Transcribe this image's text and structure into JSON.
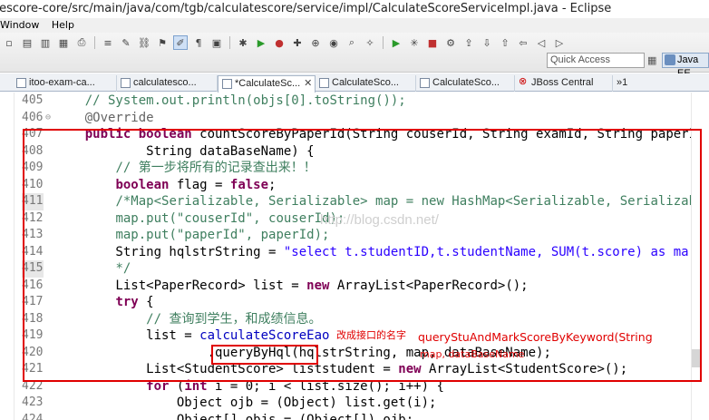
{
  "window": {
    "title": "tescore-core/src/main/java/com/tgb/calculatescore/service/impl/CalculateScoreServiceImpl.java - Eclipse"
  },
  "menu": [
    "Window",
    "Help"
  ],
  "toolbar": {
    "quick_access_placeholder": "Quick Access",
    "perspective_label": "Java EE"
  },
  "tabs": [
    {
      "label": "itoo-exam-ca...",
      "active": false,
      "closable": false
    },
    {
      "label": "calculatesco...",
      "active": false,
      "closable": false
    },
    {
      "label": "*CalculateSc...",
      "active": true,
      "closable": true
    },
    {
      "label": "CalculateSco...",
      "active": false,
      "closable": false
    },
    {
      "label": "CalculateSco...",
      "active": false,
      "closable": false
    },
    {
      "label": "JBoss Central",
      "active": false,
      "closable": false
    },
    {
      "label": "»1",
      "active": false,
      "closable": false
    }
  ],
  "editor": {
    "lines": [
      {
        "num": "405",
        "hl": false,
        "fold": "",
        "html": "    <span class=\"cm\">// System.out.println(objs[0].toString());</span>"
      },
      {
        "num": "406",
        "hl": false,
        "fold": "⊖",
        "html": "    <span class=\"an\">@Override</span>"
      },
      {
        "num": "407",
        "hl": false,
        "fold": "",
        "html": "    <span class=\"kw\">public boolean</span> countScoreByPaperId(String couserId, String examId, String paperI"
      },
      {
        "num": "408",
        "hl": false,
        "fold": "",
        "html": "            String dataBaseName) {"
      },
      {
        "num": "409",
        "hl": false,
        "fold": "",
        "html": "        <span class=\"cm\">// 第一步将所有的记录查出来！！</span>"
      },
      {
        "num": "410",
        "hl": false,
        "fold": "",
        "html": "        <span class=\"kw\">boolean</span> flag = <span class=\"kw\">false</span>;"
      },
      {
        "num": "411",
        "hl": true,
        "fold": "",
        "html": "        <span class=\"cm\">/*Map&lt;Serializable, Serializable&gt; map = new HashMap&lt;Serializable, Serializab</span>"
      },
      {
        "num": "412",
        "hl": false,
        "fold": "",
        "html": "        <span class=\"cm\">map.put(\"couserId\", couserId);</span>"
      },
      {
        "num": "413",
        "hl": false,
        "fold": "",
        "html": "        <span class=\"cm\">map.put(\"paperId\", paperId);</span>"
      },
      {
        "num": "414",
        "hl": false,
        "fold": "",
        "html": "        String hqlstrString = <span class=\"st\">\"select t.studentID,t.studentName, SUM(t.score) as mar</span>"
      },
      {
        "num": "415",
        "hl": true,
        "fold": "",
        "html": "        <span class=\"cm\">*/</span>"
      },
      {
        "num": "416",
        "hl": false,
        "fold": "",
        "html": "        List&lt;PaperRecord&gt; list = <span class=\"kw\">new</span> ArrayList&lt;PaperRecord&gt;();"
      },
      {
        "num": "417",
        "hl": false,
        "fold": "",
        "html": "        <span class=\"kw\">try</span> {"
      },
      {
        "num": "418",
        "hl": false,
        "fold": "",
        "html": "            <span class=\"cm\">// 查询到学生，和成绩信息。</span>"
      },
      {
        "num": "419",
        "hl": false,
        "fold": "",
        "html": "            list = <span class=\"fld\">calculateScoreEao</span>"
      },
      {
        "num": "420",
        "hl": false,
        "fold": "",
        "html": "                    .queryByHql(hqlstrString, map, dataBaseName);"
      },
      {
        "num": "421",
        "hl": false,
        "fold": "",
        "html": "            List&lt;StudentScore&gt; liststudent = <span class=\"kw\">new</span> ArrayList&lt;StudentScore&gt;();"
      },
      {
        "num": "422",
        "hl": false,
        "fold": "",
        "html": "            <span class=\"kw\">for</span> (<span class=\"kw\">int</span> i = 0; i &lt; list.size(); i++) {"
      },
      {
        "num": "423",
        "hl": false,
        "fold": "",
        "html": "                Object ojb = (Object) list.get(i);"
      },
      {
        "num": "424",
        "hl": false,
        "fold": "",
        "html": "                Object[] objs = (Object[]) ojb;"
      }
    ]
  },
  "annotations": {
    "note_cn": "改成接口的名字",
    "note_method": "queryStuAndMarkScoreByKeyword(String",
    "note_params": "map, dataBaseName"
  },
  "watermark": "http://blog.csdn.net/"
}
